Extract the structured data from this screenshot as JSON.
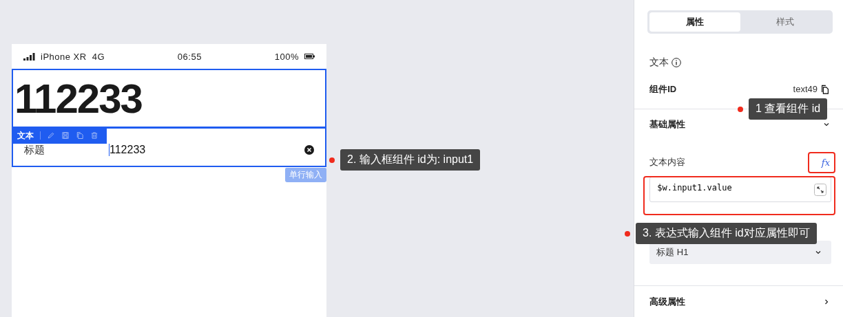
{
  "device_status": {
    "carrier": "iPhone XR",
    "network": "4G",
    "time": "06:55",
    "battery": "100%"
  },
  "canvas": {
    "text_component": {
      "value": "112233",
      "selected": true
    },
    "toolbar": {
      "label": "文本"
    },
    "input_component": {
      "label": "标题",
      "value": "112233",
      "selected": true,
      "badge": "单行输入"
    }
  },
  "panel": {
    "tabs": [
      {
        "label": "属性",
        "selected": true
      },
      {
        "label": "样式",
        "selected": false
      }
    ],
    "component_name": "文本",
    "id_label": "组件ID",
    "id_value": "text49",
    "basic_section": {
      "title": "基础属性",
      "expanded": true,
      "content_label": "文本内容",
      "formula_button": "fx",
      "content_value": "$w.input1.value",
      "format_value": "标题 H1"
    },
    "advanced_section": {
      "title": "高级属性",
      "expanded": false
    }
  },
  "annotations": [
    {
      "text": "1 查看组件 id"
    },
    {
      "text": "2. 输入框组件 id为: input1"
    },
    {
      "text": "3. 表达式输入组件 id对应属性即可"
    }
  ]
}
